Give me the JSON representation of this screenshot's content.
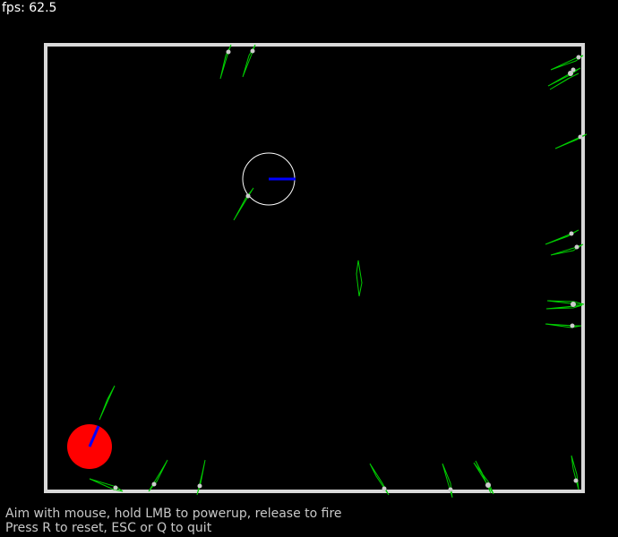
{
  "hud": {
    "fps_label": "fps: 62.5"
  },
  "help": {
    "line1": "Aim with mouse, hold LMB to powerup, release to fire",
    "line2": "Press R to reset, ESC or Q to quit"
  },
  "colors": {
    "background": "#000000",
    "walls": "#d9d9d9",
    "player": "#ff0000",
    "aim_line": "#0000ff",
    "target_ring": "#ffffff",
    "arrows": "#00cc00",
    "arrow_tip": "#cccccc",
    "hud_text": "#ffffff",
    "help_text": "#c8c8c8"
  }
}
